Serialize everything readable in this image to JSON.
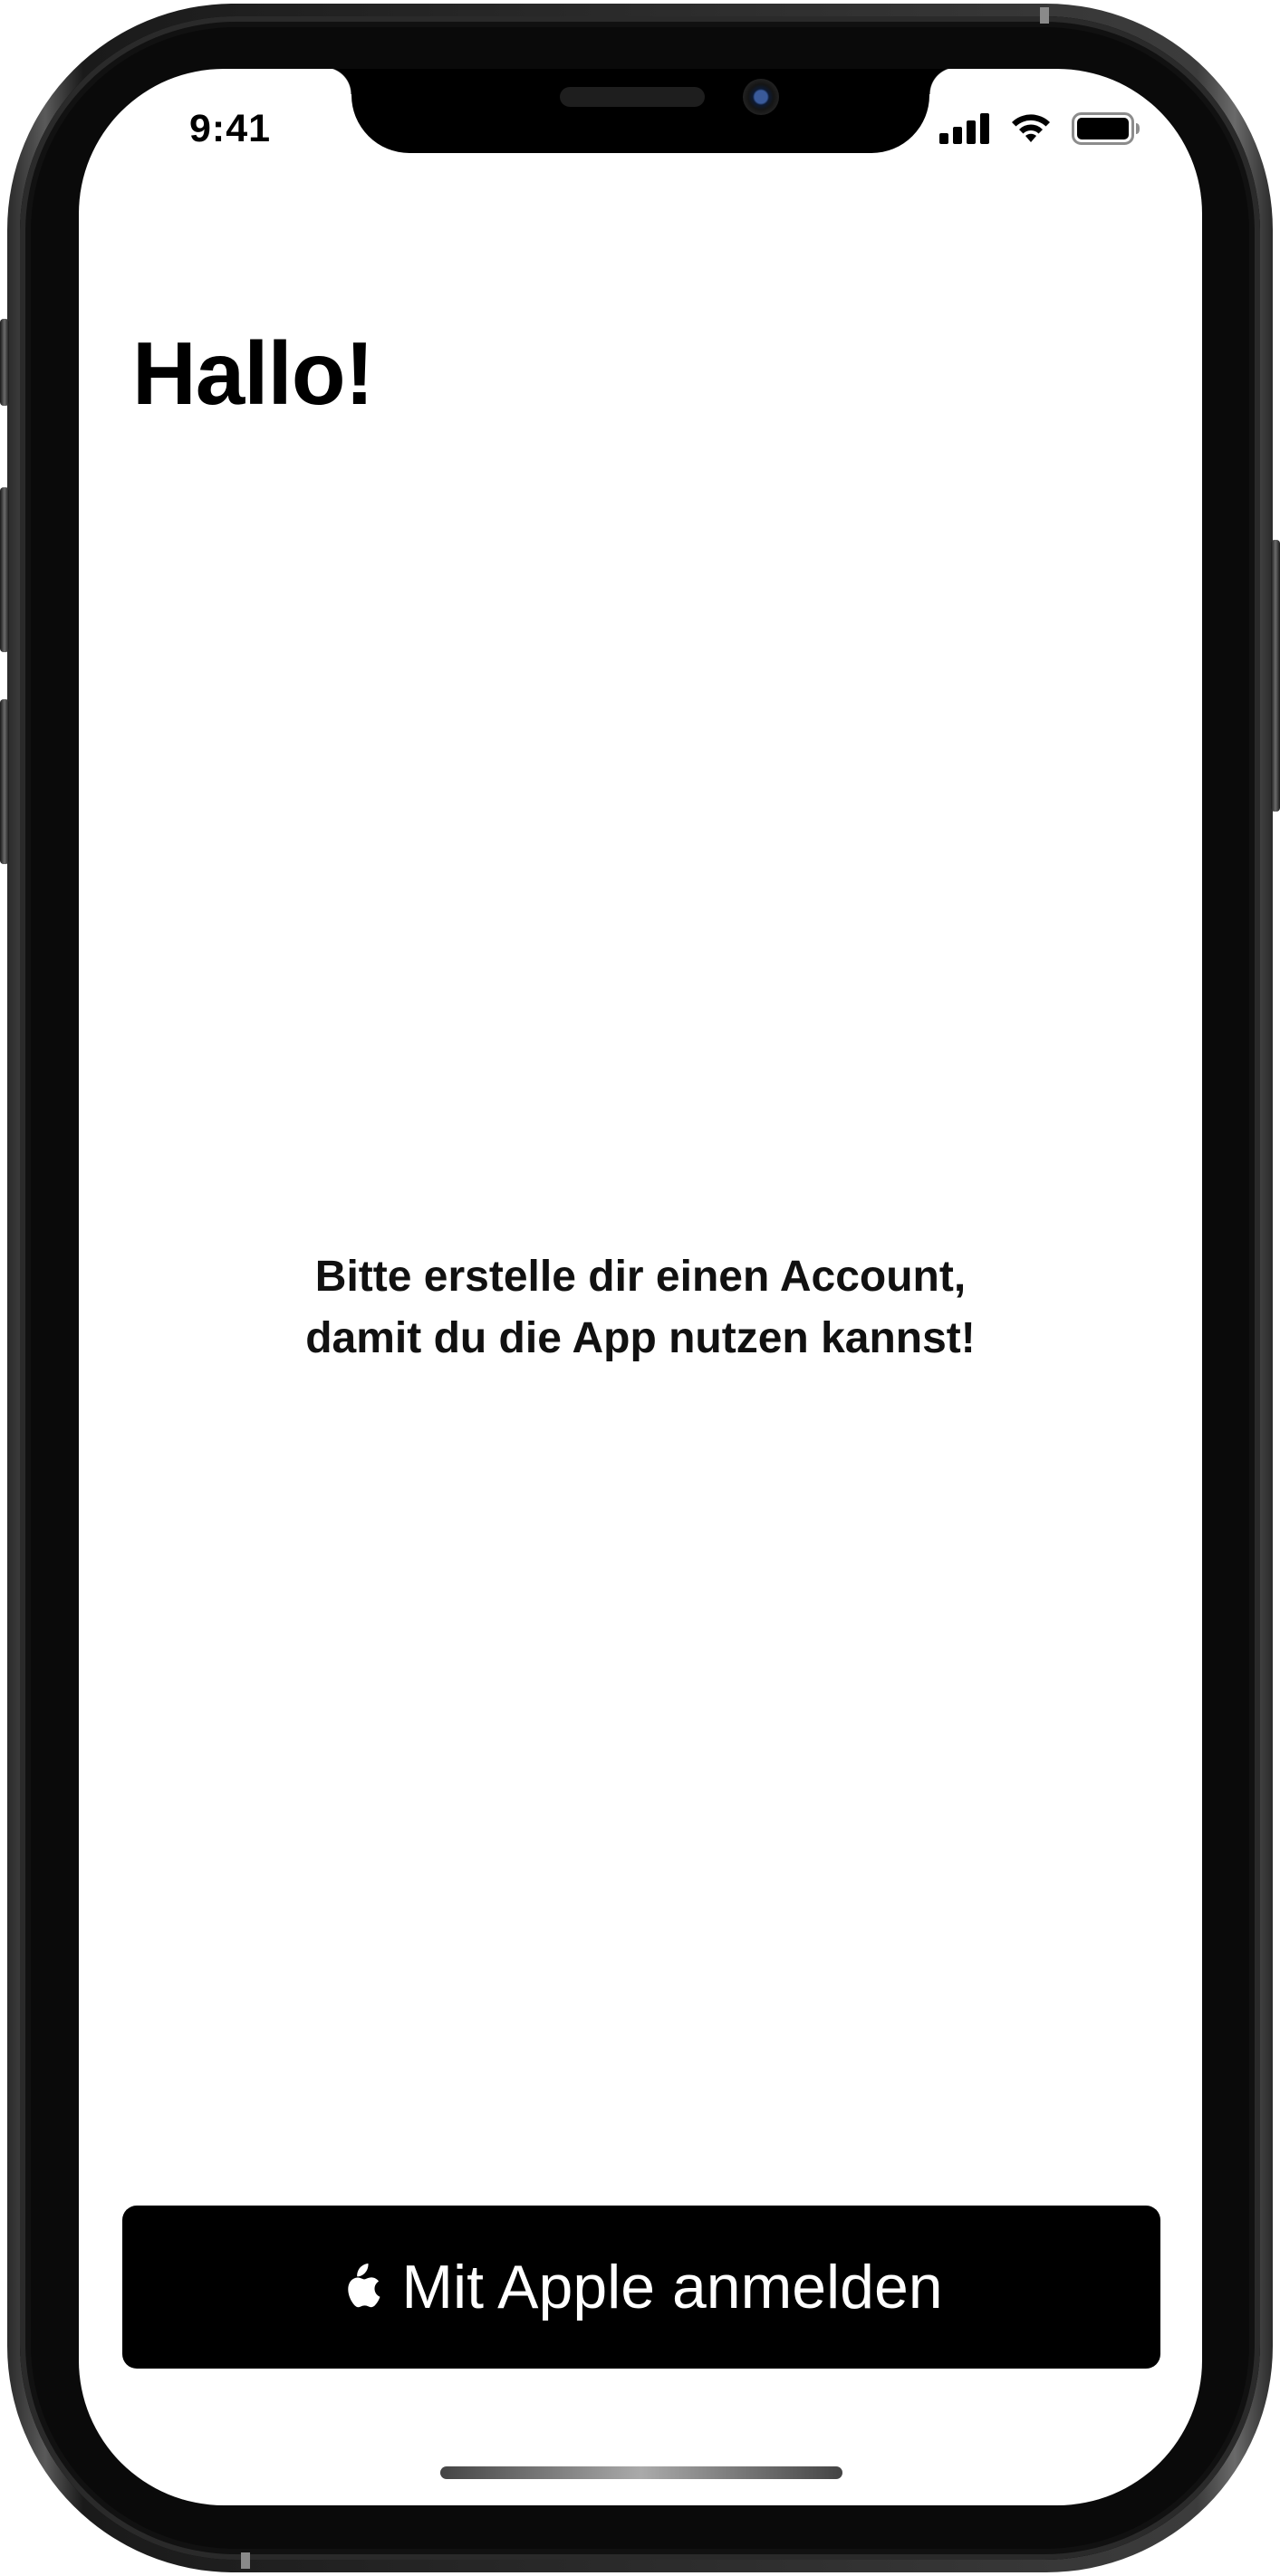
{
  "status_bar": {
    "time": "9:41",
    "icons": [
      "signal-icon",
      "wifi-icon",
      "battery-icon"
    ]
  },
  "main": {
    "title": "Hallo!",
    "message_lines": [
      "Bitte erstelle dir einen Account,",
      "damit du die App nutzen kannst!"
    ]
  },
  "sign_in": {
    "icon": "apple-logo-icon",
    "label": "Mit Apple anmelden"
  },
  "colors": {
    "button_background": "#000000",
    "button_text": "#ffffff",
    "screen_background": "#ffffff"
  }
}
